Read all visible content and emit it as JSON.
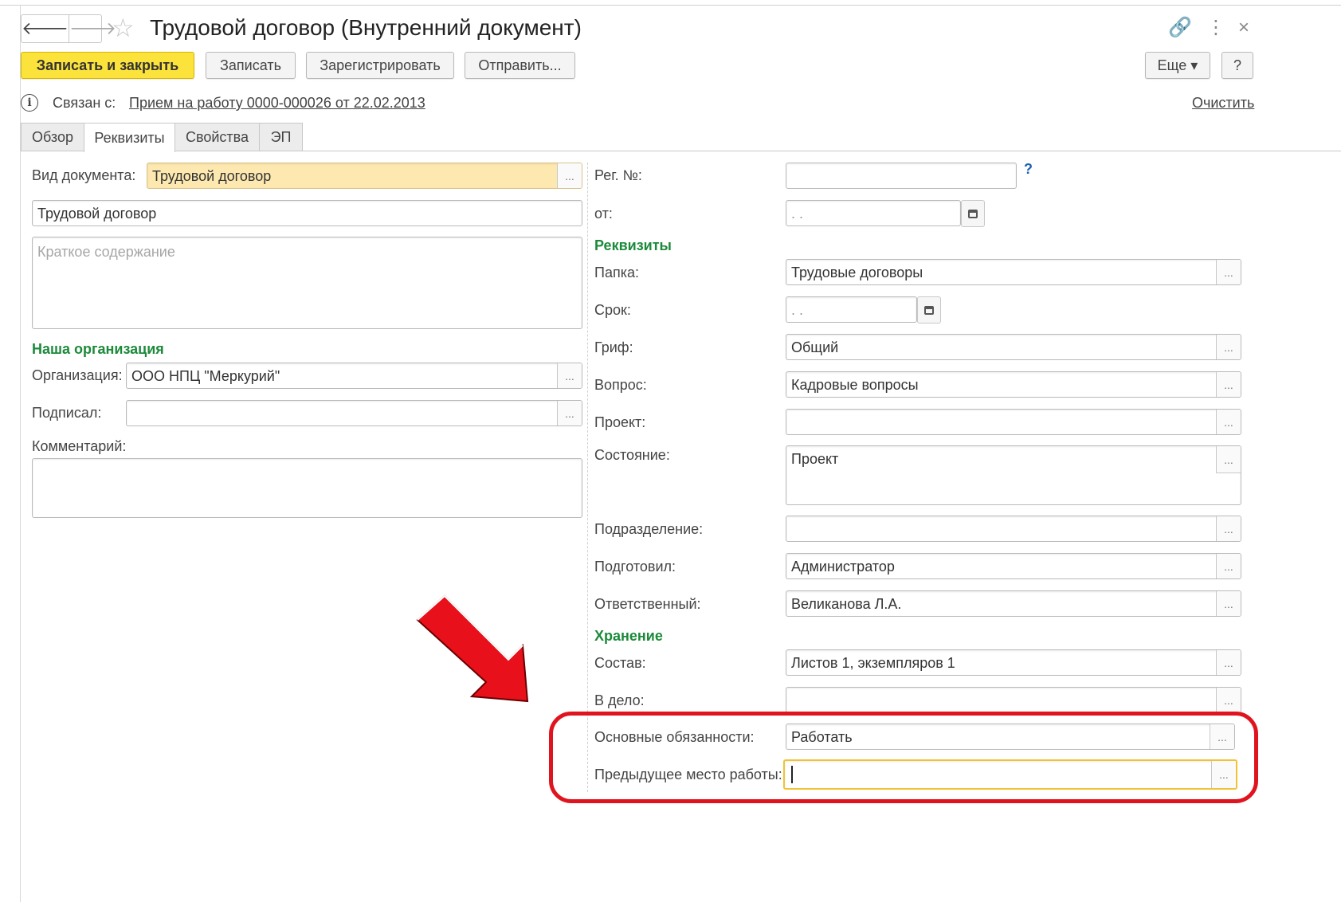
{
  "window": {
    "title": "Трудовой договор (Внутренний документ)",
    "back_glyph": "🡐",
    "forward_glyph": "🡒",
    "star_glyph": "☆",
    "link_glyph": "🔗",
    "menu_glyph": "⋮",
    "close_glyph": "×"
  },
  "toolbar": {
    "save_close": "Записать и закрыть",
    "save": "Записать",
    "register": "Зарегистрировать",
    "send": "Отправить...",
    "more": "Еще ▾",
    "help": "?"
  },
  "related": {
    "label": "Связан с:",
    "link": "Прием на работу 0000-000026 от 22.02.2013",
    "clear": "Очистить"
  },
  "tabs": [
    "Обзор",
    "Реквизиты",
    "Свойства",
    "ЭП"
  ],
  "left": {
    "doc_type_label": "Вид документа:",
    "doc_type_value": "Трудовой договор",
    "name_value": "Трудовой договор",
    "summary_placeholder": "Краткое содержание",
    "our_org_section": "Наша организация",
    "org_label": "Организация:",
    "org_value": "ООО НПЦ \"Меркурий\"",
    "signed_label": "Подписал:",
    "signed_value": "",
    "comment_label": "Комментарий:"
  },
  "right": {
    "reg_no_label": "Рег. №:",
    "reg_help": "?",
    "from_label": "от:",
    "date_placeholder": ". .",
    "requisites_section": "Реквизиты",
    "folder_label": "Папка:",
    "folder_value": "Трудовые договоры",
    "deadline_label": "Срок:",
    "grif_label": "Гриф:",
    "grif_value": "Общий",
    "question_label": "Вопрос:",
    "question_value": "Кадровые вопросы",
    "project_label": "Проект:",
    "project_value": "",
    "state_label": "Состояние:",
    "state_value": "Проект",
    "department_label": "Подразделение:",
    "department_value": "",
    "prepared_label": "Подготовил:",
    "prepared_value": "Администратор",
    "responsible_label": "Ответственный:",
    "responsible_value": "Великанова Л.А.",
    "storage_section": "Хранение",
    "composition_label": "Состав:",
    "composition_value": "Листов 1, экземпляров 1",
    "case_label": "В дело:",
    "case_value": "",
    "duties_label": "Основные обязанности:",
    "duties_value": "Работать",
    "prev_job_label": "Предыдущее место работы:",
    "prev_job_value": ""
  },
  "colors": {
    "primary_button": "#fbe33c",
    "section_heading": "#1b8a3a",
    "link": "#1e5fb4",
    "highlight": "#e0141e"
  },
  "icons": {
    "selector": "ellipsis-button",
    "calendar": "calendar-icon",
    "annotation_arrow": "red-arrow"
  }
}
